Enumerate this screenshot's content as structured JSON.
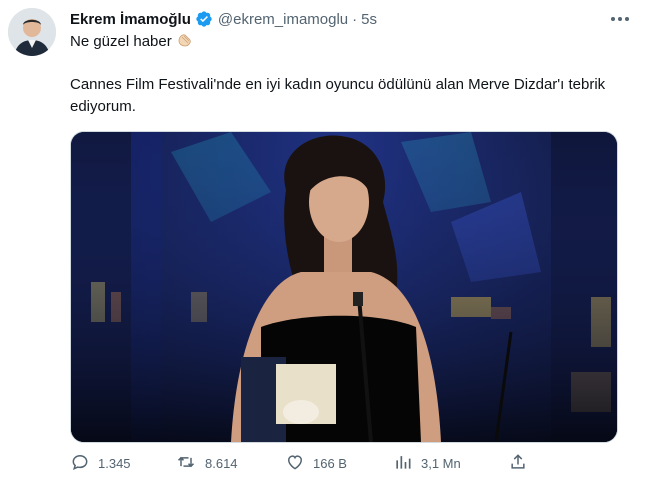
{
  "tweet": {
    "author_name": "Ekrem İmamoğlu",
    "handle": "@ekrem_imamoglu",
    "separator": "·",
    "time": "5s",
    "line1": "Ne güzel haber",
    "text": "Cannes Film Festivali'nde en iyi kadın oyuncu ödülünü alan Merve Dizdar'ı tebrik ediyorum."
  },
  "icons": {
    "verified": "verified-badge-icon",
    "more": "more-dots-icon",
    "reply": "reply-icon",
    "retweet": "retweet-icon",
    "like": "heart-icon",
    "views": "views-chart-icon",
    "share": "share-icon",
    "clap": "clapping-hands-emoji"
  },
  "stats": {
    "replies": "1.345",
    "retweets": "8.614",
    "likes": "166 B",
    "views": "3,1 Mn"
  },
  "colors": {
    "verified": "#1d9bf0",
    "text": "#0f1419",
    "secondary": "#536471"
  }
}
